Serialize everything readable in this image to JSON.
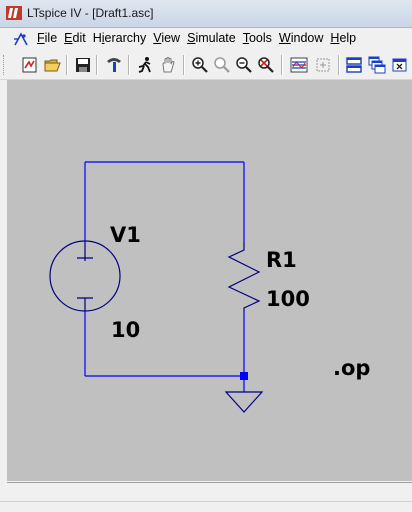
{
  "window": {
    "title": "LTspice IV - [Draft1.asc]"
  },
  "menu": {
    "items": [
      {
        "accel": "F",
        "rest": "ile"
      },
      {
        "accel": "E",
        "rest": "dit"
      },
      {
        "pre": "H",
        "accel": "i",
        "rest": "erarchy"
      },
      {
        "accel": "V",
        "rest": "iew"
      },
      {
        "accel": "S",
        "rest": "imulate"
      },
      {
        "accel": "T",
        "rest": "ools"
      },
      {
        "accel": "W",
        "rest": "indow"
      },
      {
        "accel": "H",
        "rest": "elp"
      }
    ]
  },
  "toolbar": {
    "buttons": [
      "new-schematic-icon",
      "open-icon",
      "save-icon",
      "control-panel-icon",
      "run-icon",
      "halt-icon",
      "zoom-in-icon",
      "zoom-pan-icon",
      "zoom-out-icon",
      "zoom-fit-icon",
      "waveform-icon",
      "autorange-icon",
      "tile-horizontal-icon",
      "cascade-icon",
      "close-all-icon"
    ]
  },
  "schematic": {
    "source": {
      "name": "V1",
      "value": "10"
    },
    "resistor": {
      "name": "R1",
      "value": "100"
    },
    "directive": ".op",
    "colors": {
      "background": "#c0c0c0",
      "wire": "#0000ff",
      "symbol": "#000080",
      "text": "#000000"
    }
  },
  "status": {
    "text": ""
  }
}
